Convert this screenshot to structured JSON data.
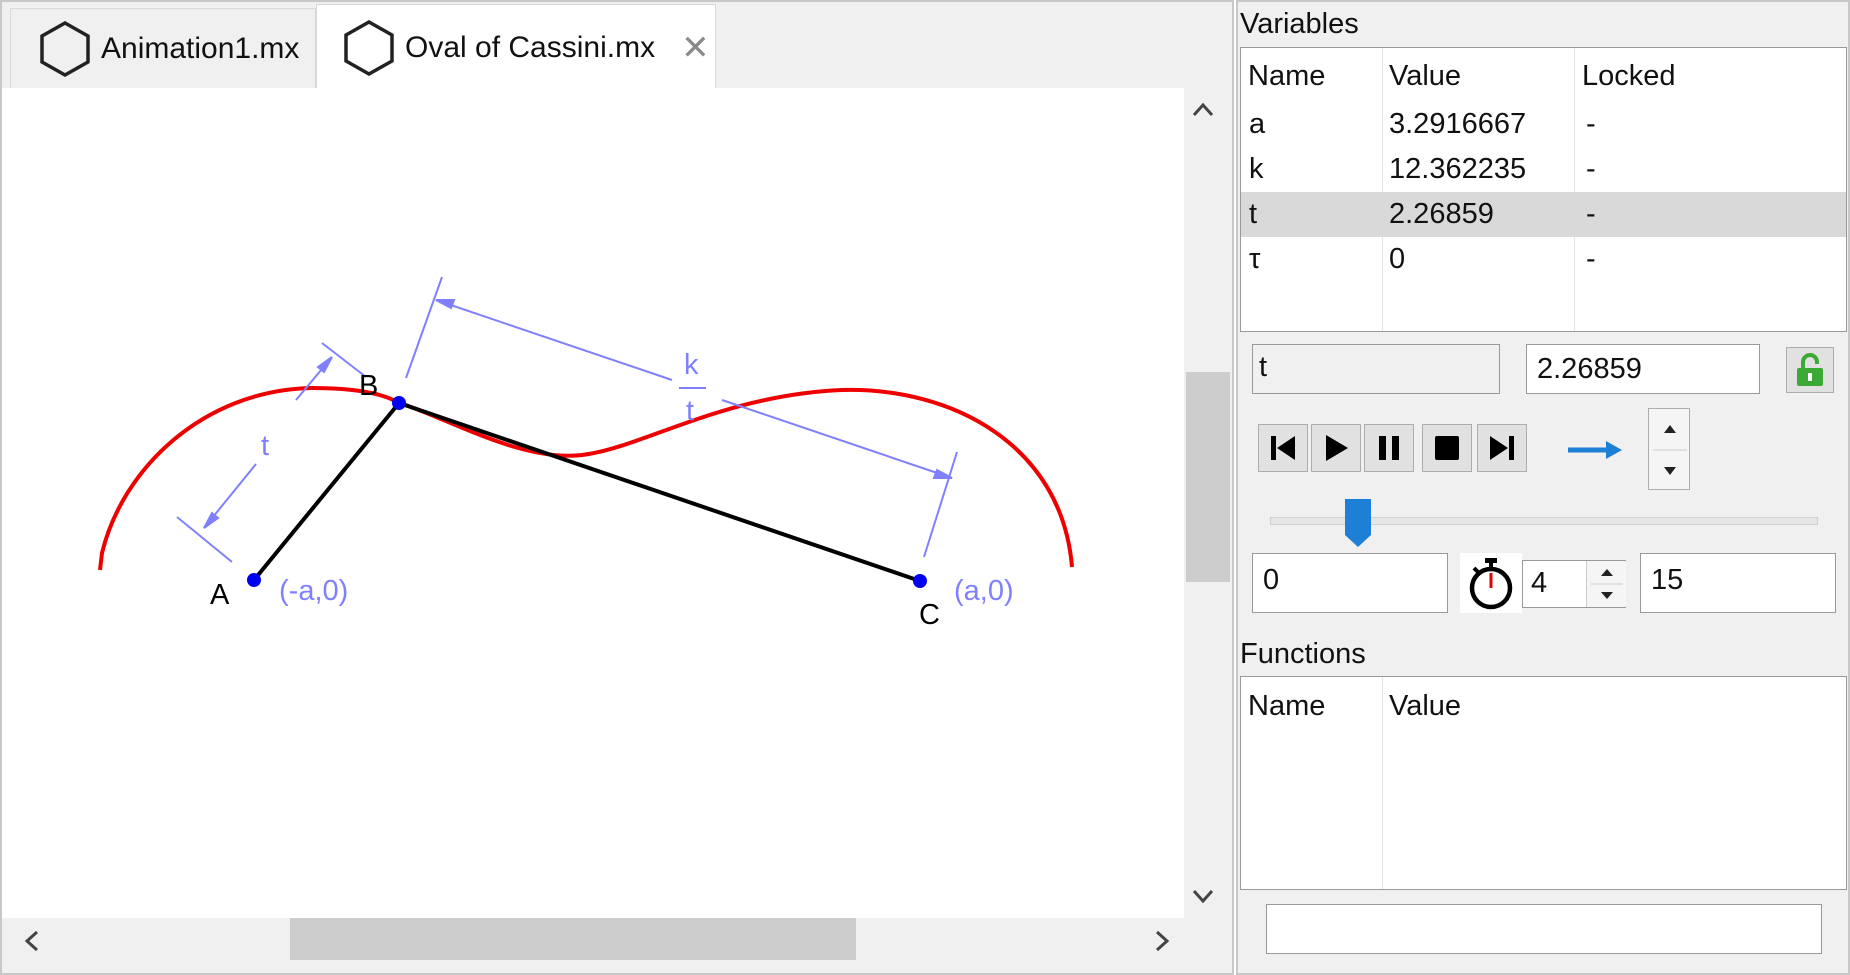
{
  "tabs": [
    {
      "label": "Animation1.mx",
      "icon": "hexagon-icon",
      "active": false
    },
    {
      "label": "Oval of Cassini.mx",
      "icon": "hexagon-icon",
      "active": true,
      "close_icon": "close-icon",
      "close_glyph": "✕"
    }
  ],
  "canvas": {
    "point_a": "A",
    "point_b": "B",
    "point_c": "C",
    "coord_a": "(-a,0)",
    "coord_c": "(a,0)",
    "dim_t": "t",
    "frac_num": "k",
    "frac_den": "t",
    "curve_color": "#ee0000",
    "segment_color": "#000000",
    "point_color": "#0000ee",
    "dimension_color": "#8080ff"
  },
  "scroll": {
    "up": "⌃",
    "down": "⌄",
    "left": "‹",
    "right": "›"
  },
  "variables": {
    "title": "Variables",
    "headers": {
      "name": "Name",
      "value": "Value",
      "locked": "Locked"
    },
    "rows": [
      {
        "name": "a",
        "value": "3.2916667",
        "locked": "-"
      },
      {
        "name": "k",
        "value": "12.362235",
        "locked": "-"
      },
      {
        "name": "t",
        "value": "2.26859",
        "locked": "-"
      },
      {
        "name": "τ",
        "value": "0",
        "locked": "-"
      }
    ],
    "selected_row": 2
  },
  "editor": {
    "name": "t",
    "value": "2.26859",
    "lock_icon": "unlocked-padlock-icon",
    "lock_color": "#3aaa35"
  },
  "playback": {
    "buttons": [
      "skip-to-start-icon",
      "play-icon",
      "pause-icon",
      "stop-icon",
      "skip-to-end-icon"
    ],
    "direction_icon": "arrow-right-icon",
    "accent": "#1e7fd6",
    "slider_position": 0.16
  },
  "animation": {
    "start": "0",
    "speed": "4",
    "end": "15",
    "timer_icon": "stopwatch-icon"
  },
  "functions": {
    "title": "Functions",
    "headers": {
      "name": "Name",
      "value": "Value"
    },
    "input": ""
  }
}
